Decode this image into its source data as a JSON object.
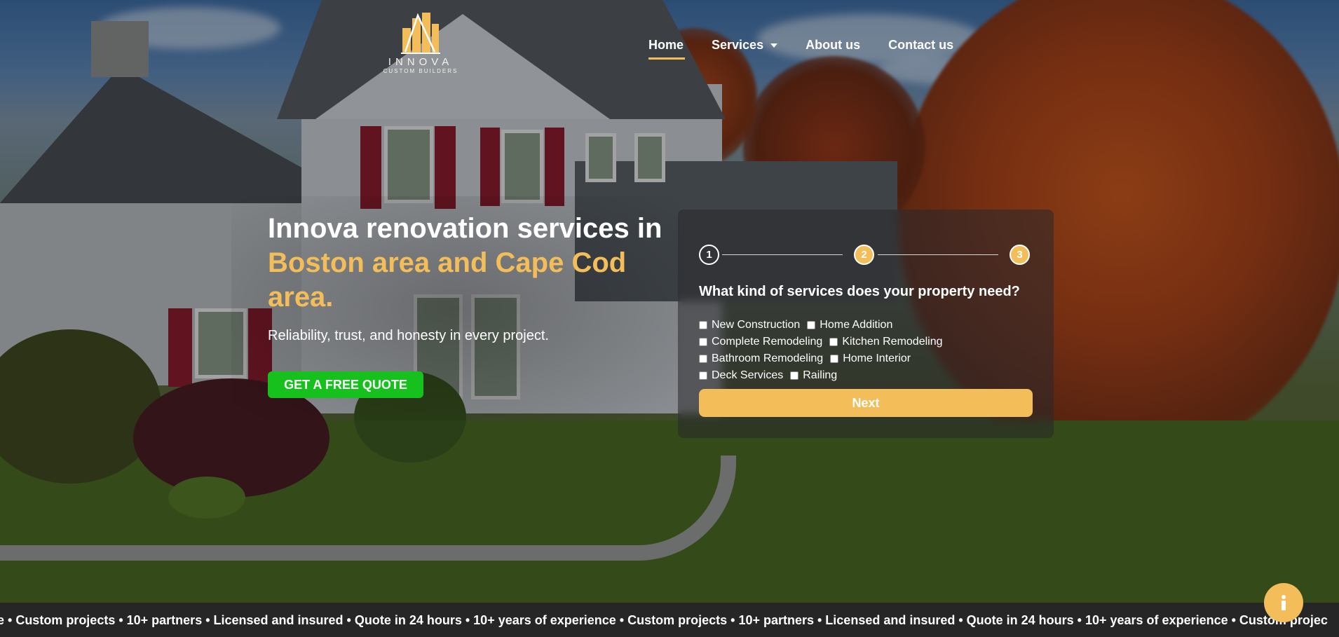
{
  "header": {
    "logo": {
      "name": "INNOVA",
      "subtitle": "CUSTOM BUILDERS"
    },
    "nav": [
      {
        "label": "Home",
        "active": true
      },
      {
        "label": "Services",
        "has_dropdown": true
      },
      {
        "label": "About us"
      },
      {
        "label": "Contact us"
      }
    ]
  },
  "hero": {
    "headline_part1": "Innova renovation services in ",
    "headline_highlight": "Boston area and Cape Cod area.",
    "tagline": "Reliability, trust, and honesty in every project.",
    "cta_label": "GET A FREE QUOTE"
  },
  "form": {
    "steps": [
      "1",
      "2",
      "3"
    ],
    "current_step": 1,
    "question": "What kind of services does your property need?",
    "options": [
      [
        "New Construction",
        "Home Addition"
      ],
      [
        "Complete Remodeling",
        "Kitchen Remodeling"
      ],
      [
        "Bathroom Remodeling",
        "Home Interior"
      ],
      [
        "Deck Services",
        "Railing"
      ]
    ],
    "next_label": "Next"
  },
  "ticker": {
    "text_start": "e • Custom projects • 10+ partners • Licensed and insured • Quote in 24 hours • 10+ years of experience • Custom projects • 10+ partners • Licensed and insured • Quote in 24 hours • 10+ years of experience • Custom projec"
  },
  "info_button": {
    "icon": "info-icon"
  },
  "colors": {
    "accent": "#f3bd5a",
    "cta_green": "#17c11d",
    "ticker_bg": "#262626"
  }
}
